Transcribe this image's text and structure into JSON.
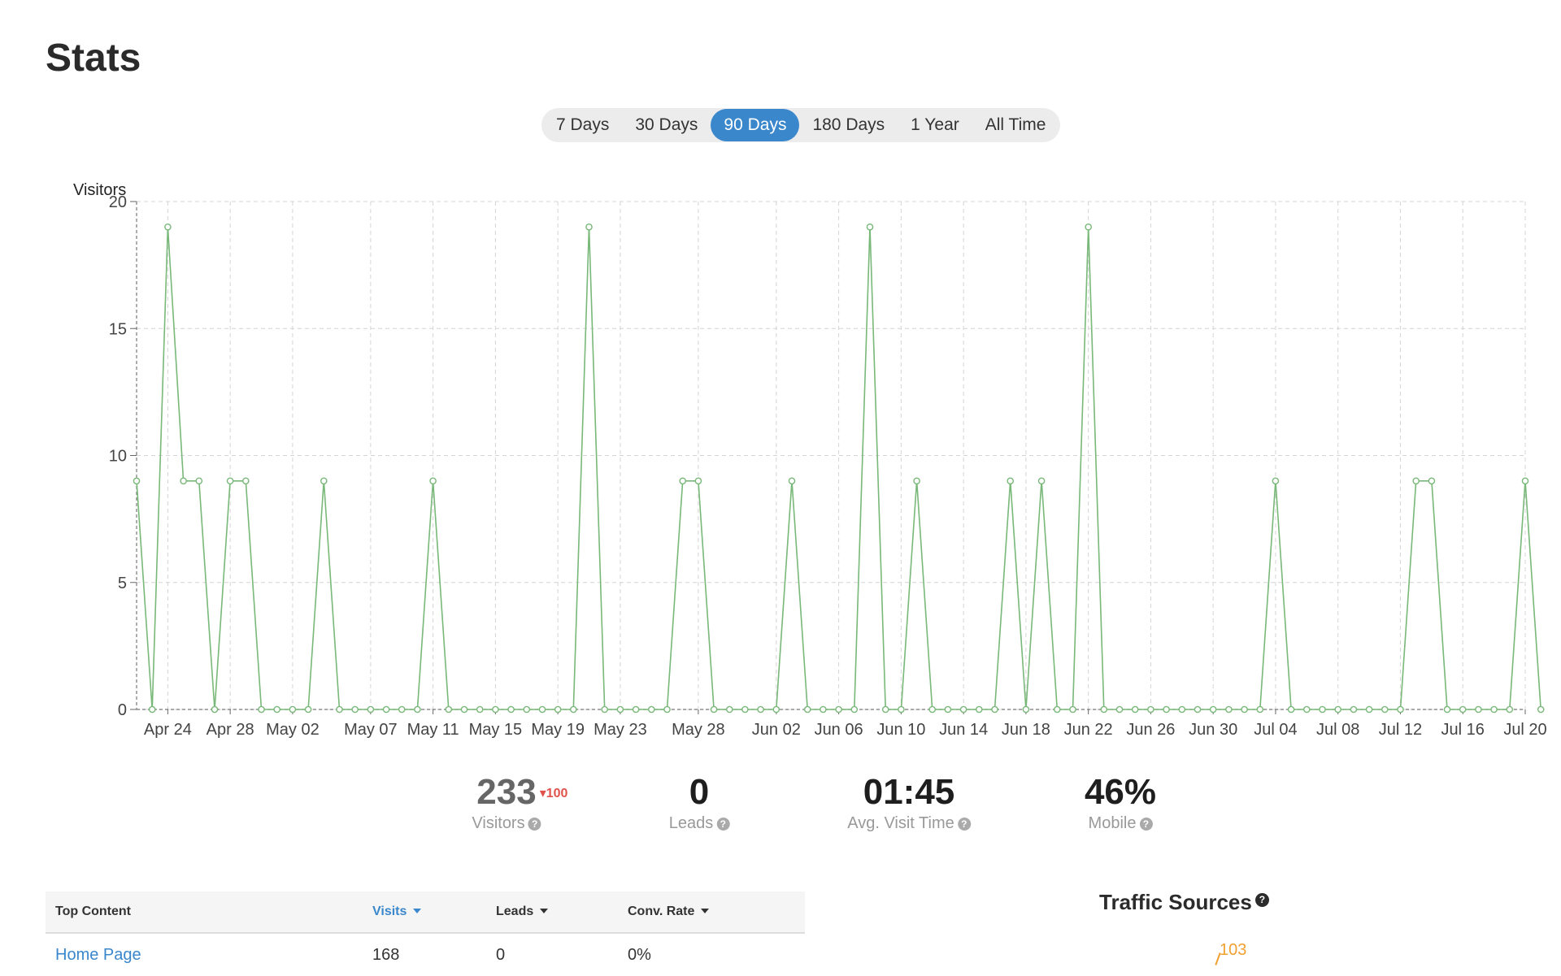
{
  "page": {
    "title": "Stats"
  },
  "ranges": [
    {
      "label": "7 Days",
      "active": false
    },
    {
      "label": "30 Days",
      "active": false
    },
    {
      "label": "90 Days",
      "active": true
    },
    {
      "label": "180 Days",
      "active": false
    },
    {
      "label": "1 Year",
      "active": false
    },
    {
      "label": "All Time",
      "active": false
    }
  ],
  "chart_data": {
    "type": "line",
    "ylabel": "Visitors",
    "ylim": [
      0,
      20
    ],
    "yticks": [
      0,
      5,
      10,
      15,
      20
    ],
    "xlim": [
      "2023-04-22",
      "2023-07-20"
    ],
    "xtick_labels": [
      "Apr 24",
      "Apr 28",
      "May 02",
      "May 07",
      "May 11",
      "May 15",
      "May 19",
      "May 23",
      "May 28",
      "Jun 02",
      "Jun 06",
      "Jun 10",
      "Jun 14",
      "Jun 18",
      "Jun 22",
      "Jun 26",
      "Jun 30",
      "Jul 04",
      "Jul 08",
      "Jul 12",
      "Jul 16",
      "Jul 20"
    ],
    "xtick_dates": [
      "2023-04-24",
      "2023-04-28",
      "2023-05-02",
      "2023-05-07",
      "2023-05-11",
      "2023-05-15",
      "2023-05-19",
      "2023-05-23",
      "2023-05-28",
      "2023-06-02",
      "2023-06-06",
      "2023-06-10",
      "2023-06-14",
      "2023-06-18",
      "2023-06-22",
      "2023-06-26",
      "2023-06-30",
      "2023-07-04",
      "2023-07-08",
      "2023-07-12",
      "2023-07-16",
      "2023-07-20"
    ],
    "grid": true,
    "series": [
      {
        "color": "#78b878",
        "points": [
          [
            "2023-04-22",
            9
          ],
          [
            "2023-04-23",
            0
          ],
          [
            "2023-04-24",
            19
          ],
          [
            "2023-04-25",
            9
          ],
          [
            "2023-04-26",
            9
          ],
          [
            "2023-04-27",
            0
          ],
          [
            "2023-04-28",
            9
          ],
          [
            "2023-04-29",
            9
          ],
          [
            "2023-04-30",
            0
          ],
          [
            "2023-05-01",
            0
          ],
          [
            "2023-05-02",
            0
          ],
          [
            "2023-05-03",
            0
          ],
          [
            "2023-05-04",
            9
          ],
          [
            "2023-05-05",
            0
          ],
          [
            "2023-05-06",
            0
          ],
          [
            "2023-05-07",
            0
          ],
          [
            "2023-05-08",
            0
          ],
          [
            "2023-05-09",
            0
          ],
          [
            "2023-05-10",
            0
          ],
          [
            "2023-05-11",
            9
          ],
          [
            "2023-05-12",
            0
          ],
          [
            "2023-05-13",
            0
          ],
          [
            "2023-05-14",
            0
          ],
          [
            "2023-05-15",
            0
          ],
          [
            "2023-05-16",
            0
          ],
          [
            "2023-05-17",
            0
          ],
          [
            "2023-05-18",
            0
          ],
          [
            "2023-05-19",
            0
          ],
          [
            "2023-05-20",
            0
          ],
          [
            "2023-05-21",
            19
          ],
          [
            "2023-05-22",
            0
          ],
          [
            "2023-05-23",
            0
          ],
          [
            "2023-05-24",
            0
          ],
          [
            "2023-05-25",
            0
          ],
          [
            "2023-05-26",
            0
          ],
          [
            "2023-05-27",
            9
          ],
          [
            "2023-05-28",
            9
          ],
          [
            "2023-05-29",
            0
          ],
          [
            "2023-05-30",
            0
          ],
          [
            "2023-05-31",
            0
          ],
          [
            "2023-06-01",
            0
          ],
          [
            "2023-06-02",
            0
          ],
          [
            "2023-06-03",
            9
          ],
          [
            "2023-06-04",
            0
          ],
          [
            "2023-06-05",
            0
          ],
          [
            "2023-06-06",
            0
          ],
          [
            "2023-06-07",
            0
          ],
          [
            "2023-06-08",
            19
          ],
          [
            "2023-06-09",
            0
          ],
          [
            "2023-06-10",
            0
          ],
          [
            "2023-06-11",
            9
          ],
          [
            "2023-06-12",
            0
          ],
          [
            "2023-06-13",
            0
          ],
          [
            "2023-06-14",
            0
          ],
          [
            "2023-06-15",
            0
          ],
          [
            "2023-06-16",
            0
          ],
          [
            "2023-06-17",
            9
          ],
          [
            "2023-06-18",
            0
          ],
          [
            "2023-06-19",
            9
          ],
          [
            "2023-06-20",
            0
          ],
          [
            "2023-06-21",
            0
          ],
          [
            "2023-06-22",
            19
          ],
          [
            "2023-06-23",
            0
          ],
          [
            "2023-06-24",
            0
          ],
          [
            "2023-06-25",
            0
          ],
          [
            "2023-06-26",
            0
          ],
          [
            "2023-06-27",
            0
          ],
          [
            "2023-06-28",
            0
          ],
          [
            "2023-06-29",
            0
          ],
          [
            "2023-06-30",
            0
          ],
          [
            "2023-07-01",
            0
          ],
          [
            "2023-07-02",
            0
          ],
          [
            "2023-07-03",
            0
          ],
          [
            "2023-07-04",
            9
          ],
          [
            "2023-07-05",
            0
          ],
          [
            "2023-07-06",
            0
          ],
          [
            "2023-07-07",
            0
          ],
          [
            "2023-07-08",
            0
          ],
          [
            "2023-07-09",
            0
          ],
          [
            "2023-07-10",
            0
          ],
          [
            "2023-07-11",
            0
          ],
          [
            "2023-07-12",
            0
          ],
          [
            "2023-07-13",
            9
          ],
          [
            "2023-07-14",
            9
          ],
          [
            "2023-07-15",
            0
          ],
          [
            "2023-07-16",
            0
          ],
          [
            "2023-07-17",
            0
          ],
          [
            "2023-07-18",
            0
          ],
          [
            "2023-07-19",
            0
          ],
          [
            "2023-07-20",
            9
          ],
          [
            "2023-07-21",
            0
          ]
        ]
      }
    ]
  },
  "stats": [
    {
      "value": "233",
      "delta": "100",
      "label": "Visitors"
    },
    {
      "value": "0",
      "label": "Leads"
    },
    {
      "value": "01:45",
      "label": "Avg. Visit Time"
    },
    {
      "value": "46%",
      "label": "Mobile"
    }
  ],
  "top_content": {
    "headers": {
      "name": "Top Content",
      "visits": "Visits",
      "leads": "Leads",
      "conv": "Conv. Rate"
    },
    "rows": [
      {
        "name": "Home Page",
        "visits": "168",
        "leads": "0",
        "conv": "0%"
      }
    ]
  },
  "traffic_sources": {
    "title": "Traffic Sources",
    "value": "103",
    "color": "#f0a030"
  },
  "icons": {
    "help": "help-icon",
    "delta": "caret-down-icon",
    "sort": "sort-caret-icon"
  }
}
